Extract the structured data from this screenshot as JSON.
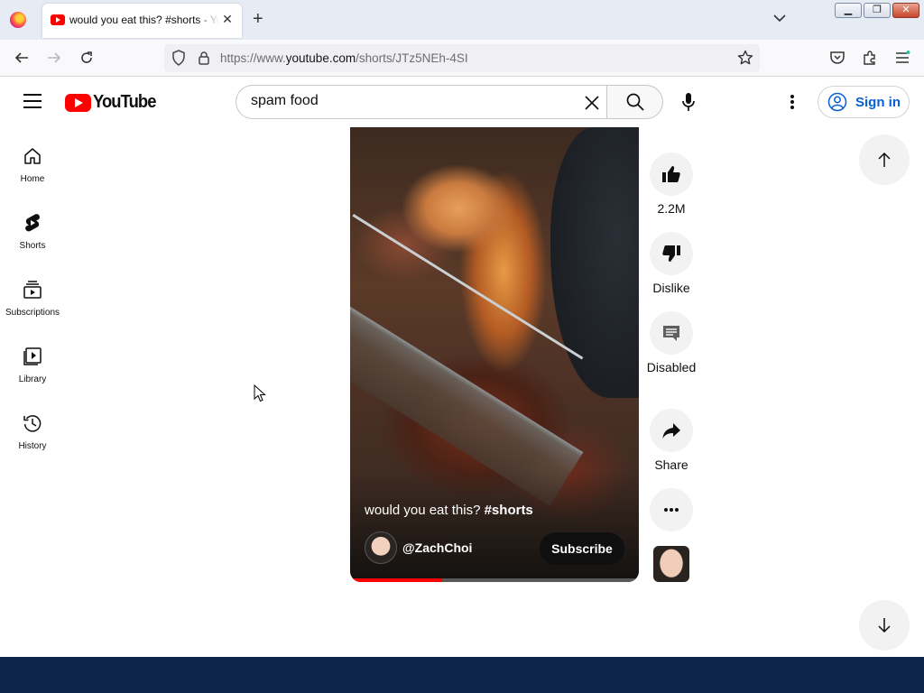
{
  "browser": {
    "tab_title": "would you eat this? #shorts - YouTube",
    "url_prefix": "https://www.",
    "url_domain": "youtube.com",
    "url_path": "/shorts/JTz5NEh-4SI"
  },
  "header": {
    "logo_text": "YouTube",
    "search_value": "spam food",
    "signin_label": "Sign in"
  },
  "sidebar": {
    "items": [
      {
        "label": "Home",
        "icon": "home-icon"
      },
      {
        "label": "Shorts",
        "icon": "shorts-icon"
      },
      {
        "label": "Subscriptions",
        "icon": "subscriptions-icon"
      },
      {
        "label": "Library",
        "icon": "library-icon"
      },
      {
        "label": "History",
        "icon": "history-icon"
      }
    ]
  },
  "short": {
    "title_plain": "would you eat this? ",
    "title_tag": "#shorts",
    "channel": "@ZachChoi",
    "subscribe_label": "Subscribe",
    "progress": 0.32
  },
  "actions": {
    "like_count": "2.2M",
    "dislike_label": "Dislike",
    "comments_label": "Disabled",
    "share_label": "Share"
  },
  "colors": {
    "brand_red": "#ff0000",
    "link_blue": "#065fd4",
    "taskbar": "#0c2447"
  }
}
